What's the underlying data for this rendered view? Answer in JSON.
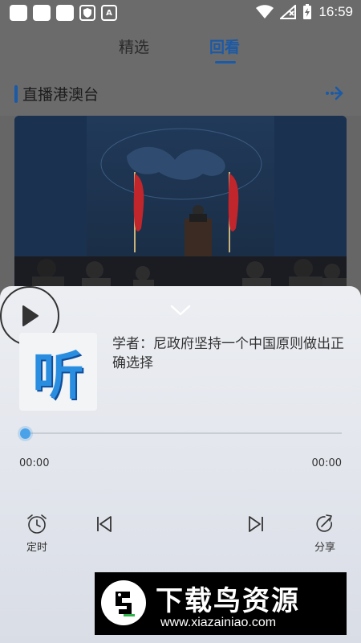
{
  "statusbar": {
    "time": "16:59",
    "badge_a": "A"
  },
  "tabs": [
    {
      "label": "精选"
    },
    {
      "label": "回看"
    }
  ],
  "section": {
    "title": "直播港澳台"
  },
  "player": {
    "title": "学者：尼政府坚持一个中国原则做出正确选择",
    "cover_text": "听",
    "time_current": "00:00",
    "time_total": "00:00",
    "progress": 0,
    "timer_label": "定时",
    "share_label": "分享"
  },
  "watermark": {
    "title": "下载鸟资源",
    "url": "www.xiazainiao.com"
  },
  "colors": {
    "accent": "#1b5aa6",
    "progress": "#4aa3e8"
  }
}
